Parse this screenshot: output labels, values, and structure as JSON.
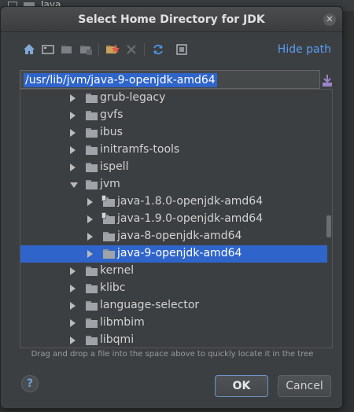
{
  "background": {
    "label": "Java"
  },
  "dialog": {
    "title": "Select Home Directory for JDK",
    "close_glyph": "✕"
  },
  "toolbar": {
    "buttons": [
      {
        "icon": "home-icon"
      },
      {
        "icon": "desktop-icon"
      },
      {
        "icon": "folder-icon"
      },
      {
        "icon": "folder-up-icon"
      },
      {
        "icon": "new-folder-icon"
      },
      {
        "icon": "delete-icon"
      },
      {
        "icon": "refresh-icon"
      },
      {
        "icon": "show-hidden-icon"
      }
    ],
    "hide_path_label": "Hide path"
  },
  "path": {
    "value": "/usr/lib/jvm/java-9-openjdk-amd64"
  },
  "tree": {
    "items": [
      {
        "label": "grub-legacy",
        "state": "collapsed",
        "depth": 0,
        "link": false
      },
      {
        "label": "gvfs",
        "state": "collapsed",
        "depth": 0,
        "link": false
      },
      {
        "label": "ibus",
        "state": "collapsed",
        "depth": 0,
        "link": false
      },
      {
        "label": "initramfs-tools",
        "state": "collapsed",
        "depth": 0,
        "link": false
      },
      {
        "label": "ispell",
        "state": "collapsed",
        "depth": 0,
        "link": false
      },
      {
        "label": "jvm",
        "state": "expanded",
        "depth": 0,
        "link": false
      },
      {
        "label": "java-1.8.0-openjdk-amd64",
        "state": "collapsed",
        "depth": 1,
        "link": true
      },
      {
        "label": "java-1.9.0-openjdk-amd64",
        "state": "collapsed",
        "depth": 1,
        "link": true
      },
      {
        "label": "java-8-openjdk-amd64",
        "state": "collapsed",
        "depth": 1,
        "link": false
      },
      {
        "label": "java-9-openjdk-amd64",
        "state": "collapsed",
        "depth": 1,
        "link": false,
        "selected": true
      },
      {
        "label": "kernel",
        "state": "collapsed",
        "depth": 0,
        "link": false
      },
      {
        "label": "klibc",
        "state": "collapsed",
        "depth": 0,
        "link": false
      },
      {
        "label": "language-selector",
        "state": "collapsed",
        "depth": 0,
        "link": false
      },
      {
        "label": "libmbim",
        "state": "collapsed",
        "depth": 0,
        "link": false
      },
      {
        "label": "libqmi",
        "state": "collapsed",
        "depth": 0,
        "link": false
      }
    ]
  },
  "hint": "Drag and drop a file into the space above to quickly locate it in the tree",
  "footer": {
    "help_glyph": "?",
    "ok_label": "OK",
    "cancel_label": "Cancel"
  },
  "colors": {
    "accent": "#589df6",
    "selection": "#2f65ca",
    "background": "#3c3f41"
  }
}
